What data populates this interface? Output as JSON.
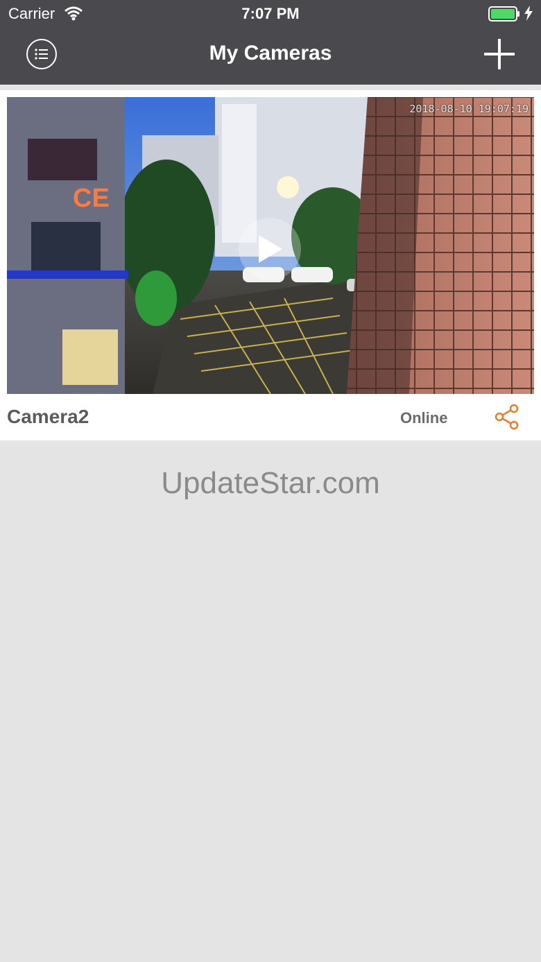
{
  "status_bar": {
    "carrier": "Carrier",
    "time": "7:07 PM"
  },
  "nav": {
    "title": "My Cameras",
    "menu_icon": "list-icon",
    "add_icon": "plus-icon"
  },
  "camera": {
    "name": "Camera2",
    "status": "Online",
    "timestamp": "2018-08-10 19:07:19",
    "share_icon": "share-icon"
  },
  "watermark": "UpdateStar.com",
  "colors": {
    "nav_bg": "#4a4a4e",
    "accent": "#f07a2a",
    "page_bg": "#e4e4e4"
  }
}
